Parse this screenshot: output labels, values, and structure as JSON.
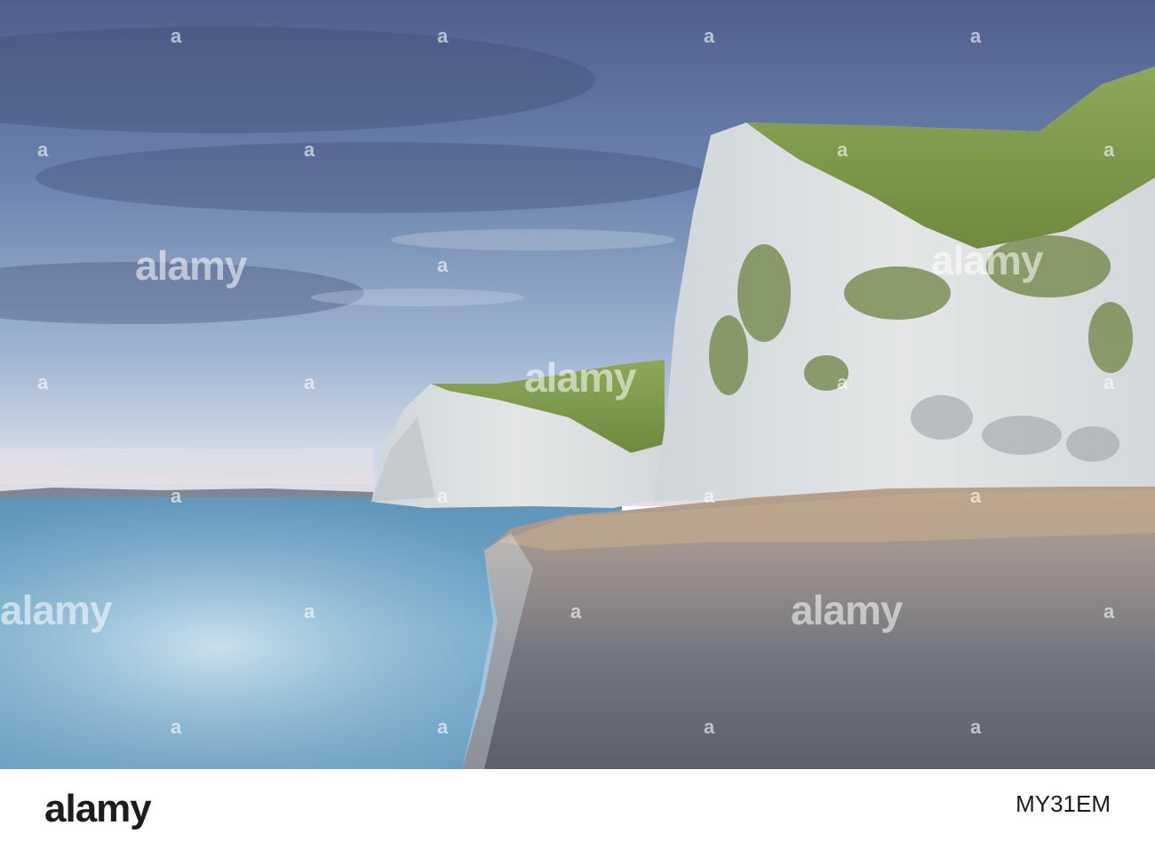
{
  "photo": {
    "scene": "coastal-chalk-cliffs-shingle-beach",
    "colors": {
      "sky_top": "#5b6f9a",
      "sky_mid": "#8fa6c8",
      "sky_horizon": "#cfd8e6",
      "cliff_chalk": "#dfe2e3",
      "cliff_shadow": "#aeb4b8",
      "grass": "#7d9a4a",
      "sea": "#6fa8c9",
      "sea_foam": "#c4dbea",
      "shingle": "#7d7f86",
      "sand": "#b89f88"
    }
  },
  "watermark": {
    "brand": "alamy",
    "icon": "alamy-a-icon"
  },
  "footer": {
    "logo": "alamy",
    "image_id": "MY31EM"
  }
}
